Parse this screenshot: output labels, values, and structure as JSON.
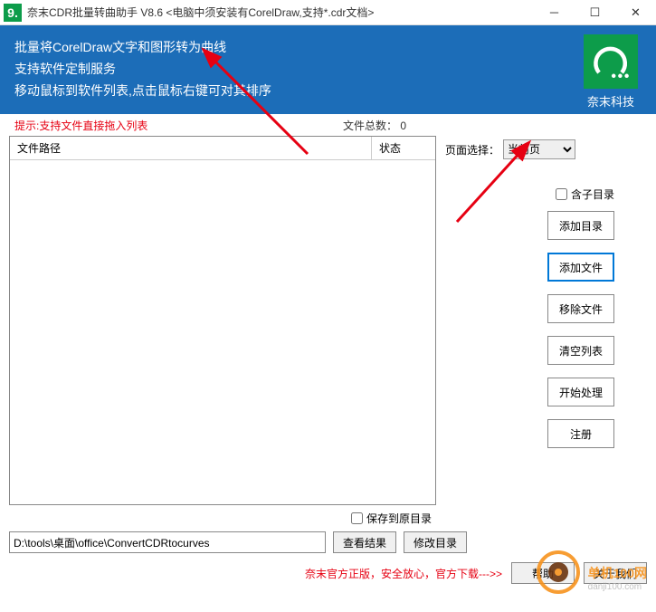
{
  "titlebar": {
    "title": "奈末CDR批量转曲助手 V8.6   <电脑中须安装有CorelDraw,支持*.cdr文档>"
  },
  "banner": {
    "line1": "批量将CorelDraw文字和图形转为曲线",
    "line2": "支持软件定制服务",
    "line3": "移动鼠标到软件列表,点击鼠标右键可对其排序",
    "brand": "奈末科技"
  },
  "hint": {
    "text": "提示:支持文件直接拖入列表",
    "file_count_label": "文件总数：",
    "file_count_value": "0"
  },
  "table": {
    "col_path": "文件路径",
    "col_status": "状态"
  },
  "side": {
    "page_select_label": "页面选择：",
    "page_select_value": "当前页",
    "include_subdir": "含子目录",
    "add_dir": "添加目录",
    "add_file": "添加文件",
    "remove_file": "移除文件",
    "clear_list": "清空列表",
    "start_process": "开始处理",
    "register": "注册"
  },
  "bottom": {
    "save_original_dir": "保存到原目录",
    "output_path": "D:\\tools\\桌面\\office\\ConvertCDRtocurves",
    "view_result": "查看结果",
    "modify_dir": "修改目录"
  },
  "footer": {
    "label": "奈末官方正版，安全放心，官方下载--->>",
    "help": "帮助",
    "about": "关于我们"
  },
  "watermark": {
    "name": "单机100网",
    "url": "danji100.com"
  }
}
